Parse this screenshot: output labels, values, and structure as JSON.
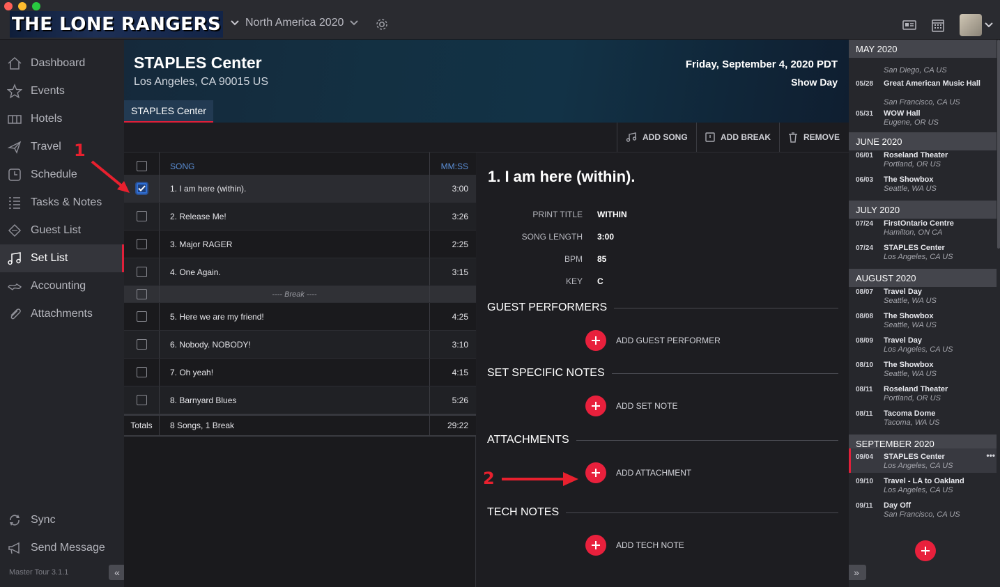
{
  "app": {
    "logo_text": "THE LONE RANGERS",
    "tour_name": "North America 2020",
    "version": "Master Tour 3.1.1"
  },
  "sidebar": {
    "items": [
      {
        "label": "Dashboard",
        "icon": "home-icon"
      },
      {
        "label": "Events",
        "icon": "star-icon"
      },
      {
        "label": "Hotels",
        "icon": "hotel-icon"
      },
      {
        "label": "Travel",
        "icon": "plane-icon"
      },
      {
        "label": "Schedule",
        "icon": "clock-icon"
      },
      {
        "label": "Tasks & Notes",
        "icon": "list-icon"
      },
      {
        "label": "Guest List",
        "icon": "ticket-icon"
      },
      {
        "label": "Set List",
        "icon": "music-note-icon",
        "active": true
      },
      {
        "label": "Accounting",
        "icon": "money-icon"
      },
      {
        "label": "Attachments",
        "icon": "paperclip-icon"
      }
    ],
    "bottom": [
      {
        "label": "Sync",
        "icon": "sync-icon"
      },
      {
        "label": "Send Message",
        "icon": "megaphone-icon"
      }
    ]
  },
  "venue": {
    "name": "STAPLES Center",
    "address": "Los Angeles, CA 90015 US",
    "date": "Friday, September 4, 2020 PDT",
    "day_type": "Show Day",
    "tab_label": "STAPLES Center"
  },
  "toolbar": {
    "add_song": "ADD SONG",
    "add_break": "ADD BREAK",
    "remove": "REMOVE"
  },
  "setlist": {
    "header_song": "SONG",
    "header_time": "MM:SS",
    "rows": [
      {
        "type": "song",
        "title": "1. I am here (within).",
        "time": "3:00",
        "checked": true
      },
      {
        "type": "song",
        "title": "2. Release Me!",
        "time": "3:26",
        "checked": false
      },
      {
        "type": "song",
        "title": "3. Major RAGER",
        "time": "2:25",
        "checked": false
      },
      {
        "type": "song",
        "title": "4. One Again.",
        "time": "3:15",
        "checked": false
      },
      {
        "type": "break",
        "title": "---- Break ----",
        "time": "",
        "checked": false
      },
      {
        "type": "song",
        "title": "5. Here we are my friend!",
        "time": "4:25",
        "checked": false
      },
      {
        "type": "song",
        "title": "6. Nobody. NOBODY!",
        "time": "3:10",
        "checked": false
      },
      {
        "type": "song",
        "title": "7. Oh yeah!",
        "time": "4:15",
        "checked": false
      },
      {
        "type": "song",
        "title": "8. Barnyard Blues",
        "time": "5:26",
        "checked": false
      }
    ],
    "totals_label": "Totals",
    "totals_summary": "8 Songs, 1 Break",
    "totals_time": "29:22"
  },
  "detail": {
    "title": "1. I am here (within).",
    "fields": [
      {
        "key": "PRINT TITLE",
        "value": "WITHIN"
      },
      {
        "key": "SONG LENGTH",
        "value": "3:00"
      },
      {
        "key": "BPM",
        "value": "85"
      },
      {
        "key": "KEY",
        "value": "C"
      }
    ],
    "sections": [
      {
        "title": "GUEST PERFORMERS",
        "add_label": "ADD GUEST PERFORMER"
      },
      {
        "title": "SET SPECIFIC NOTES",
        "add_label": "ADD SET NOTE"
      },
      {
        "title": "ATTACHMENTS",
        "add_label": "ADD ATTACHMENT"
      },
      {
        "title": "TECH NOTES",
        "add_label": "ADD TECH NOTE"
      }
    ]
  },
  "annotations": {
    "one": "1",
    "two": "2"
  },
  "calendar": {
    "months": [
      {
        "label": "MAY 2020",
        "events": [
          {
            "date": "",
            "name": "",
            "location": "San Diego, CA US"
          },
          {
            "date": "05/28",
            "name": "Great American Music Hall",
            "location": "San Francisco, CA US"
          },
          {
            "date": "05/31",
            "name": "WOW Hall",
            "location": "Eugene, OR US"
          }
        ]
      },
      {
        "label": "JUNE 2020",
        "events": [
          {
            "date": "06/01",
            "name": "Roseland Theater",
            "location": "Portland, OR US"
          },
          {
            "date": "06/03",
            "name": "The Showbox",
            "location": "Seattle, WA US"
          }
        ]
      },
      {
        "label": "JULY 2020",
        "events": [
          {
            "date": "07/24",
            "name": "FirstOntario Centre",
            "location": "Hamilton, ON CA"
          },
          {
            "date": "07/24",
            "name": "STAPLES Center",
            "location": "Los Angeles, CA US"
          }
        ]
      },
      {
        "label": "AUGUST 2020",
        "events": [
          {
            "date": "08/07",
            "name": "Travel Day",
            "location": "Seattle, WA US"
          },
          {
            "date": "08/08",
            "name": "The Showbox",
            "location": "Seattle, WA US"
          },
          {
            "date": "08/09",
            "name": "Travel Day",
            "location": "Los Angeles, CA US"
          },
          {
            "date": "08/10",
            "name": "The Showbox",
            "location": "Seattle, WA US"
          },
          {
            "date": "08/11",
            "name": "Roseland Theater",
            "location": "Portland, OR US"
          },
          {
            "date": "08/11",
            "name": "Tacoma Dome",
            "location": "Tacoma, WA US"
          }
        ]
      },
      {
        "label": "SEPTEMBER 2020",
        "events": [
          {
            "date": "09/04",
            "name": "STAPLES Center",
            "location": "Los Angeles, CA US",
            "active": true
          },
          {
            "date": "09/10",
            "name": "Travel - LA to Oakland",
            "location": "Los Angeles, CA US"
          },
          {
            "date": "09/11",
            "name": "Day Off",
            "location": "San Francisco, CA US"
          }
        ]
      }
    ],
    "more_label": "•••"
  },
  "colors": {
    "accent": "#e8203c",
    "active_bar": "#e0203a",
    "link_blue": "#5b8fd6"
  }
}
